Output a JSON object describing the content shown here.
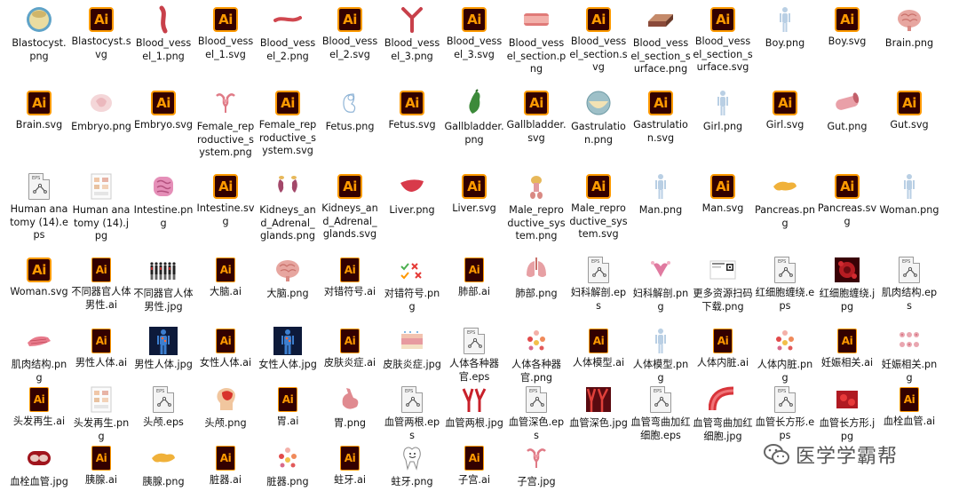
{
  "items": [
    {
      "label": "Blastocyst.png",
      "icon": "blastocyst-thumb"
    },
    {
      "label": "Blastocyst.svg",
      "icon": "ai"
    },
    {
      "label": "Blood_vessel_1.png",
      "icon": "vessel-curve-thumb"
    },
    {
      "label": "Blood_vessel_1.svg",
      "icon": "ai"
    },
    {
      "label": "Blood_vessel_2.png",
      "icon": "vessel-flat-thumb"
    },
    {
      "label": "Blood_vessel_2.svg",
      "icon": "ai"
    },
    {
      "label": "Blood_vessel_3.png",
      "icon": "vessel-fork-thumb"
    },
    {
      "label": "Blood_vessel_3.svg",
      "icon": "ai"
    },
    {
      "label": "Blood_vessel_section.png",
      "icon": "vessel-section-thumb"
    },
    {
      "label": "Blood_vessel_section.svg",
      "icon": "ai"
    },
    {
      "label": "Blood_vessel_section_surface.png",
      "icon": "vessel-surface-thumb"
    },
    {
      "label": "Blood_vessel_section_surface.svg",
      "icon": "ai"
    },
    {
      "label": "Boy.png",
      "icon": "figure-thumb"
    },
    {
      "label": "Boy.svg",
      "icon": "ai"
    },
    {
      "label": "Brain.png",
      "icon": "brain-thumb"
    },
    {
      "label": "Brain.svg",
      "icon": "ai"
    },
    {
      "label": "Embryo.png",
      "icon": "embryo-thumb"
    },
    {
      "label": "Embryo.svg",
      "icon": "ai"
    },
    {
      "label": "Female_reproductive_system.png",
      "icon": "uterus-thumb"
    },
    {
      "label": "Female_reproductive_system.svg",
      "icon": "ai"
    },
    {
      "label": "Fetus.png",
      "icon": "fetus-thumb"
    },
    {
      "label": "Fetus.svg",
      "icon": "ai"
    },
    {
      "label": "Gallbladder.png",
      "icon": "gallbladder-thumb"
    },
    {
      "label": "Gallbladder.svg",
      "icon": "ai"
    },
    {
      "label": "Gastrulation.png",
      "icon": "gastrulation-thumb"
    },
    {
      "label": "Gastrulation.svg",
      "icon": "ai"
    },
    {
      "label": "Girl.png",
      "icon": "figure-thumb"
    },
    {
      "label": "Girl.svg",
      "icon": "ai"
    },
    {
      "label": "Gut.png",
      "icon": "gut-thumb"
    },
    {
      "label": "Gut.svg",
      "icon": "ai"
    },
    {
      "label": "Human anatomy (14).eps",
      "icon": "eps"
    },
    {
      "label": "Human anatomy (14).jpg",
      "icon": "chart-doc-thumb"
    },
    {
      "label": "Intestine.png",
      "icon": "intestine-thumb"
    },
    {
      "label": "Intestine.svg",
      "icon": "ai"
    },
    {
      "label": "Kidneys_and_Adrenal_glands.png",
      "icon": "kidney-thumb"
    },
    {
      "label": "Kidneys_and_Adrenal_glands.svg",
      "icon": "ai"
    },
    {
      "label": "Liver.png",
      "icon": "liver-thumb"
    },
    {
      "label": "Liver.svg",
      "icon": "ai"
    },
    {
      "label": "Male_reproductive_system.png",
      "icon": "male-repro-thumb"
    },
    {
      "label": "Male_reproductive_system.svg",
      "icon": "ai"
    },
    {
      "label": "Man.png",
      "icon": "figure-thumb"
    },
    {
      "label": "Man.svg",
      "icon": "ai"
    },
    {
      "label": "Pancreas.png",
      "icon": "pancreas-thumb"
    },
    {
      "label": "Pancreas.svg",
      "icon": "ai"
    },
    {
      "label": "Woman.png",
      "icon": "figure-thumb"
    },
    {
      "label": "Woman.svg",
      "icon": "ai"
    },
    {
      "label": "不同器官人体男性.ai",
      "icon": "ai-small"
    },
    {
      "label": "不同器官人体男性.jpg",
      "icon": "bodies-thumb"
    },
    {
      "label": "大脑.ai",
      "icon": "ai-small"
    },
    {
      "label": "大脑.png",
      "icon": "brain-thumb"
    },
    {
      "label": "对错符号.ai",
      "icon": "ai-small"
    },
    {
      "label": "对错符号.png",
      "icon": "symbols-thumb"
    },
    {
      "label": "肺部.ai",
      "icon": "ai-small"
    },
    {
      "label": "肺部.png",
      "icon": "lungs-thumb"
    },
    {
      "label": "妇科解剖.eps",
      "icon": "eps"
    },
    {
      "label": "妇科解剖.png",
      "icon": "gyn-thumb"
    },
    {
      "label": "更多资源扫码下载.png",
      "icon": "qr-thumb"
    },
    {
      "label": "红细胞缠绕.eps",
      "icon": "eps"
    },
    {
      "label": "红细胞缠绕.jpg",
      "icon": "rbc-thumb"
    },
    {
      "label": "肌肉结构.eps",
      "icon": "eps"
    },
    {
      "label": "肌肉结构.png",
      "icon": "muscle-thumb"
    },
    {
      "label": "男性人体.ai",
      "icon": "ai-small"
    },
    {
      "label": "男性人体.jpg",
      "icon": "dark-body-thumb"
    },
    {
      "label": "女性人体.ai",
      "icon": "ai-small"
    },
    {
      "label": "女性人体.jpg",
      "icon": "dark-body-thumb"
    },
    {
      "label": "皮肤炎症.ai",
      "icon": "ai-small"
    },
    {
      "label": "皮肤炎症.jpg",
      "icon": "skin-thumb"
    },
    {
      "label": "人体各种器官.eps",
      "icon": "eps"
    },
    {
      "label": "人体各种器官.png",
      "icon": "organs-thumb"
    },
    {
      "label": "人体模型.ai",
      "icon": "ai-small"
    },
    {
      "label": "人体模型.png",
      "icon": "figure-thumb"
    },
    {
      "label": "人体内脏.ai",
      "icon": "ai-small"
    },
    {
      "label": "人体内脏.png",
      "icon": "organs-thumb"
    },
    {
      "label": "妊娠相关.ai",
      "icon": "ai-small"
    },
    {
      "label": "妊娠相关.png",
      "icon": "preg-thumb"
    },
    {
      "label": "头发再生.ai",
      "icon": "ai-small"
    },
    {
      "label": "头发再生.png",
      "icon": "chart-doc-thumb"
    },
    {
      "label": "头颅.eps",
      "icon": "eps"
    },
    {
      "label": "头颅.png",
      "icon": "head-thumb"
    },
    {
      "label": "胃.ai",
      "icon": "ai-small"
    },
    {
      "label": "胃.png",
      "icon": "stomach-thumb"
    },
    {
      "label": "血管两根.eps",
      "icon": "eps"
    },
    {
      "label": "血管两根.jpg",
      "icon": "red-vessel-thumb"
    },
    {
      "label": "血管深色.eps",
      "icon": "eps"
    },
    {
      "label": "血管深色.jpg",
      "icon": "dark-vessel-thumb"
    },
    {
      "label": "血管弯曲加红细胞.eps",
      "icon": "eps"
    },
    {
      "label": "血管弯曲加红细胞.jpg",
      "icon": "bend-vessel-thumb"
    },
    {
      "label": "血管长方形.eps",
      "icon": "eps"
    },
    {
      "label": "血管长方形.jpg",
      "icon": "rect-vessel-thumb"
    },
    {
      "label": "血栓血管.ai",
      "icon": "ai-small"
    },
    {
      "label": "血栓血管.jpg",
      "icon": "clot-thumb"
    },
    {
      "label": "胰腺.ai",
      "icon": "ai-small"
    },
    {
      "label": "胰腺.png",
      "icon": "pancreas-thumb"
    },
    {
      "label": "脏器.ai",
      "icon": "ai-small"
    },
    {
      "label": "脏器.png",
      "icon": "organs-thumb"
    },
    {
      "label": "蛀牙.ai",
      "icon": "ai-small"
    },
    {
      "label": "蛀牙.png",
      "icon": "tooth-thumb"
    },
    {
      "label": "子宫.ai",
      "icon": "ai-small"
    },
    {
      "label": "子宫.jpg",
      "icon": "uterus-thumb"
    }
  ],
  "ai_glyph": "Ai",
  "eps_glyph": "EPS",
  "watermark": {
    "text": "医学学霸帮",
    "icon": "wechat-icon"
  }
}
